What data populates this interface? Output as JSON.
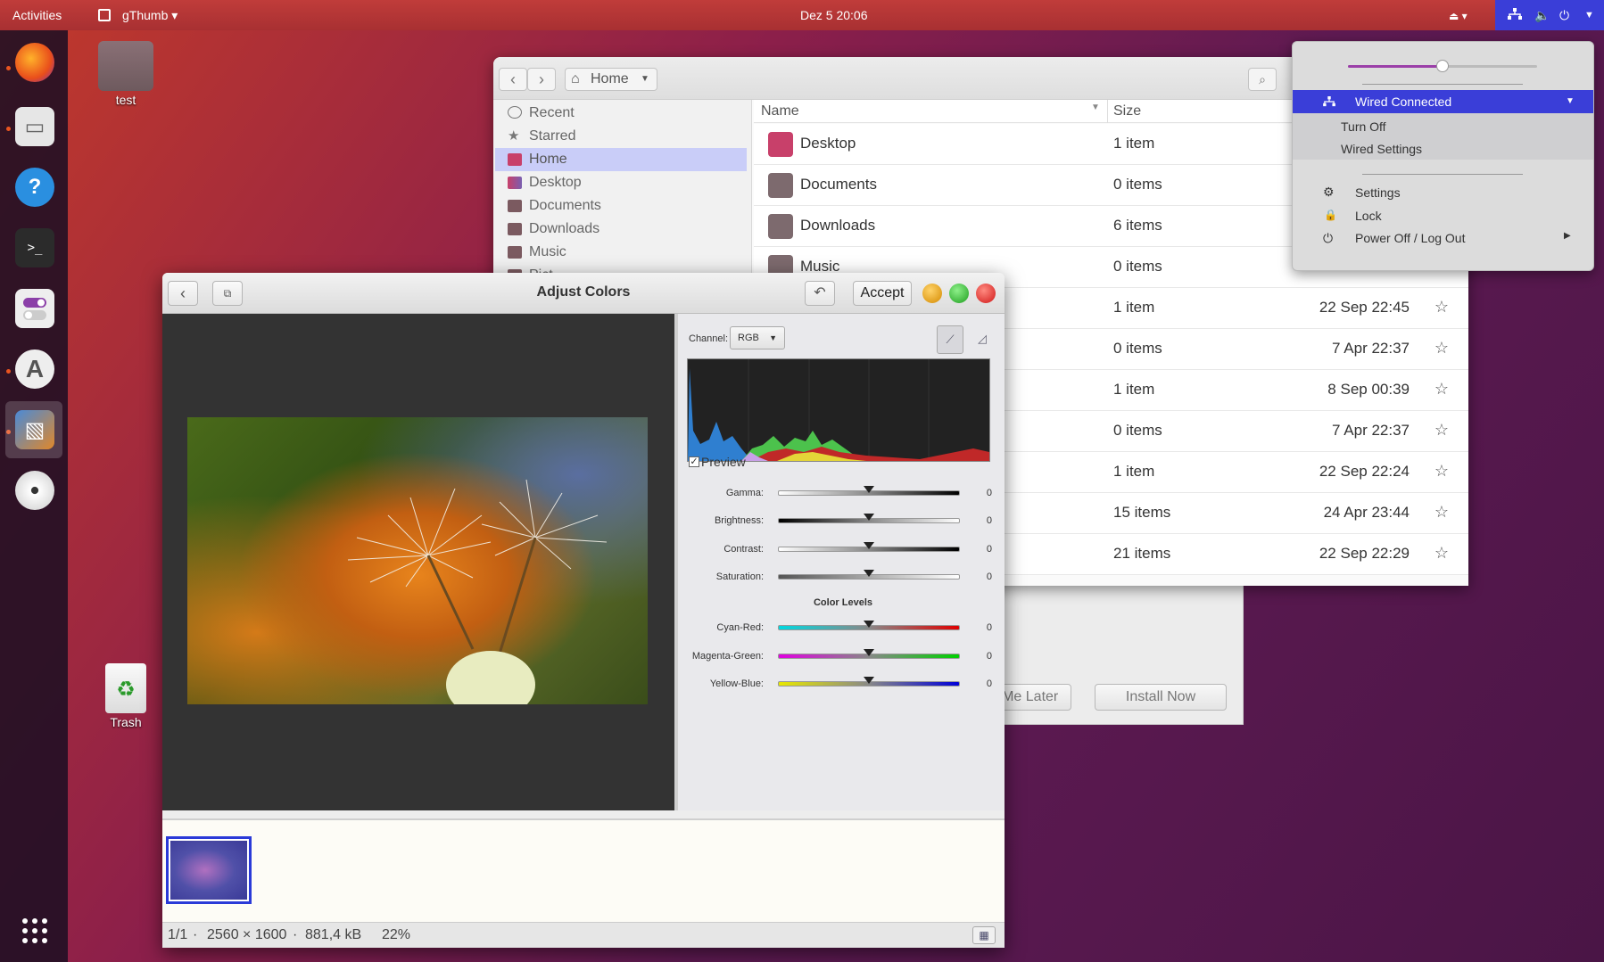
{
  "topbar": {
    "activities": "Activities",
    "app_name": "gThumb",
    "clock": "Dez 5  20:06"
  },
  "desktop": {
    "folder_label": "test",
    "trash_label": "Trash"
  },
  "nautilus": {
    "location": "Home",
    "sidebar": [
      {
        "label": "Recent"
      },
      {
        "label": "Starred"
      },
      {
        "label": "Home"
      },
      {
        "label": "Desktop"
      },
      {
        "label": "Documents"
      },
      {
        "label": "Downloads"
      },
      {
        "label": "Music"
      },
      {
        "label": "Pict"
      }
    ],
    "columns": {
      "name": "Name",
      "size": "Size"
    },
    "rows": [
      {
        "name": "Desktop",
        "size": "1 item",
        "date": "",
        "color": "#c8406a"
      },
      {
        "name": "Documents",
        "size": "0 items",
        "date": "",
        "color": "#7d6a6e"
      },
      {
        "name": "Downloads",
        "size": "6 items",
        "date": "",
        "color": "#7d6a6e"
      },
      {
        "name": "Music",
        "size": "0 items",
        "date": "",
        "color": "#7d6a6e"
      },
      {
        "name": "",
        "size": "1 item",
        "date": "22 Sep 22:45",
        "color": "#7d6a6e"
      },
      {
        "name": "",
        "size": "0 items",
        "date": "7 Apr 22:37",
        "color": "#7d6a6e"
      },
      {
        "name": "",
        "size": "1 item",
        "date": "8 Sep 00:39",
        "color": "#7d6a6e"
      },
      {
        "name": "",
        "size": "0 items",
        "date": "7 Apr 22:37",
        "color": "#7d6a6e"
      },
      {
        "name": "",
        "size": "1 item",
        "date": "22 Sep 22:24",
        "color": "#7d6a6e"
      },
      {
        "name": "",
        "size": "15 items",
        "date": "24 Apr 23:44",
        "color": "#7d6a6e"
      },
      {
        "name": "",
        "size": "21 items",
        "date": "22 Sep 22:29",
        "color": "#7d6a6e"
      }
    ]
  },
  "update_dialog": {
    "remind_label": "d Me Later",
    "install_label": "Install Now"
  },
  "gthumb": {
    "title": "Adjust Colors",
    "accept_label": "Accept",
    "channel_label": "Channel:",
    "channel_value": "RGB",
    "preview_label": "Preview",
    "color_levels_heading": "Color Levels",
    "sliders": [
      {
        "label": "Gamma:",
        "value": "0",
        "style": "gray-dark"
      },
      {
        "label": "Brightness:",
        "value": "0",
        "style": "dark-light"
      },
      {
        "label": "Contrast:",
        "value": "0",
        "style": "gray-dark"
      },
      {
        "label": "Saturation:",
        "value": "0",
        "style": "gray-light"
      },
      {
        "label": "Cyan-Red:",
        "value": "0",
        "style": "cyan-red"
      },
      {
        "label": "Magenta-Green:",
        "value": "0",
        "style": "magenta-green"
      },
      {
        "label": "Yellow-Blue:",
        "value": "0",
        "style": "yellow-blue"
      }
    ],
    "status": {
      "position": "1/1",
      "dimensions": "2560 × 1600",
      "filesize": "881,4 kB",
      "zoom": "22%"
    }
  },
  "system_menu": {
    "volume_level": 0.5,
    "network_label": "Wired Connected",
    "turn_off": "Turn Off",
    "wired_settings": "Wired Settings",
    "settings": "Settings",
    "lock": "Lock",
    "power": "Power Off / Log Out"
  },
  "colors": {
    "accent": "#3a3ed8",
    "ubuntu_orange": "#e95420",
    "selection": "#c9cdf8"
  }
}
